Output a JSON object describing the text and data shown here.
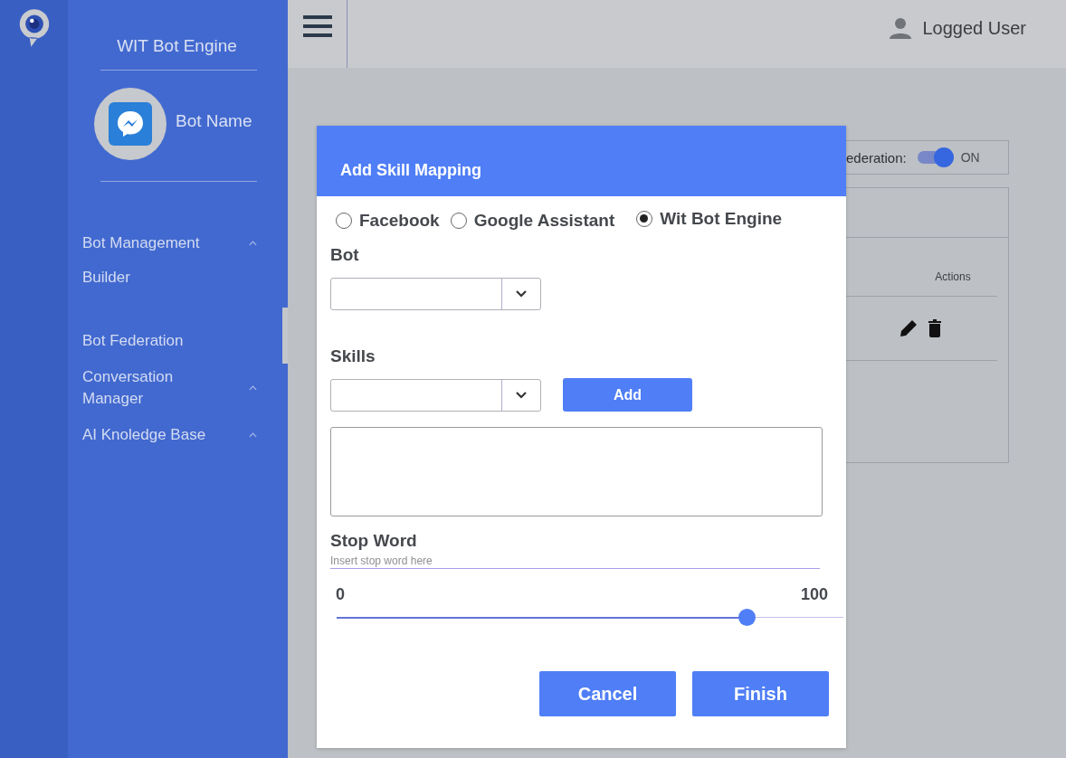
{
  "app": {
    "title": "WIT Bot Engine",
    "bot_name": "Bot Name",
    "user": "Logged User"
  },
  "sidebar": {
    "items": [
      {
        "label": "Bot Management",
        "expanded": true,
        "children": [
          {
            "label": "Builder"
          }
        ]
      },
      {
        "label": "Bot Federation"
      },
      {
        "label": "Conversation Manager",
        "expanded": true
      },
      {
        "label": "AI Knoledge Base",
        "expanded": true
      }
    ]
  },
  "federation": {
    "label": "ederation:",
    "on": true,
    "state_label": "ON"
  },
  "table": {
    "columns": [
      "Actions"
    ]
  },
  "dialog": {
    "title": "Add Skill Mapping",
    "platforms": [
      {
        "label": "Facebook",
        "selected": false
      },
      {
        "label": "Google Assistant",
        "selected": false
      },
      {
        "label": "Wit Bot Engine",
        "selected": true
      }
    ],
    "bot_label": "Bot",
    "skills_label": "Skills",
    "add_button": "Add",
    "stop_word": {
      "label": "Stop Word",
      "placeholder": "Insert stop word here"
    },
    "threshold": {
      "min": "0",
      "max": "100",
      "level": 0.81
    },
    "buttons": [
      "Cancel",
      "Finish"
    ]
  }
}
